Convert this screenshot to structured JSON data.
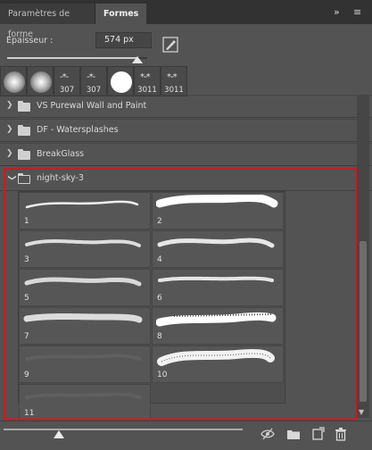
{
  "tabs": [
    {
      "label": "Paramètres de forme"
    },
    {
      "label": "Formes"
    }
  ],
  "tabbar_icons": {
    "expand": "double-chevron-right-icon",
    "menu": "hamburger-menu-icon"
  },
  "size": {
    "label": "Epaisseur :",
    "value": "574 px",
    "slider_fraction": 0.93
  },
  "recent_brushes": [
    {
      "kind": "soft-round",
      "label": ""
    },
    {
      "kind": "soft-round",
      "label": ""
    },
    {
      "kind": "sprite",
      "label": "307"
    },
    {
      "kind": "sprite",
      "label": "307"
    },
    {
      "kind": "hard-round",
      "label": ""
    },
    {
      "kind": "sprite",
      "label": "3011"
    },
    {
      "kind": "sprite",
      "label": "3011"
    }
  ],
  "groups": [
    {
      "label": "VS Purewal Wall and Paint",
      "expanded": false
    },
    {
      "label": "DF - Watersplashes",
      "expanded": false
    },
    {
      "label": "BreakGlass",
      "expanded": false
    },
    {
      "label": "night-sky-3",
      "expanded": true
    }
  ],
  "brushes": [
    {
      "n": "1"
    },
    {
      "n": "2"
    },
    {
      "n": "3"
    },
    {
      "n": "4"
    },
    {
      "n": "5"
    },
    {
      "n": "6"
    },
    {
      "n": "7"
    },
    {
      "n": "8"
    },
    {
      "n": "9"
    },
    {
      "n": "10"
    },
    {
      "n": "11"
    }
  ],
  "bottom_icons": [
    "visibility-icon",
    "new-group-folder-icon",
    "new-brush-icon",
    "trash-icon"
  ],
  "colors": {
    "panel_bg": "#535353",
    "highlight_box": "#d0191c"
  }
}
